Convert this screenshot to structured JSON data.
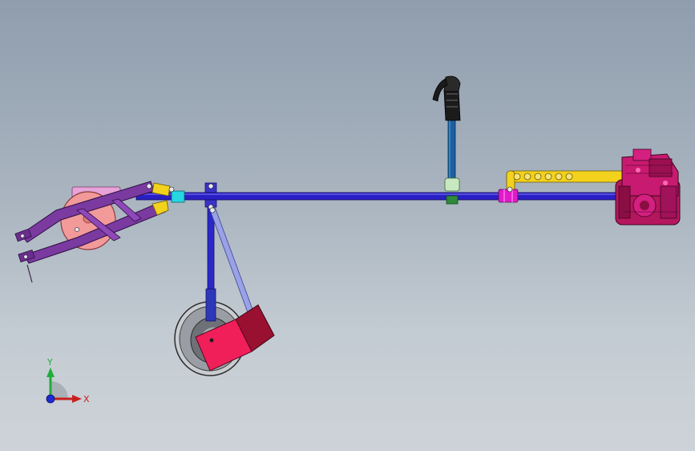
{
  "triad": {
    "y_label": "Y",
    "x_label": "X"
  },
  "colors": {
    "background_top": "#8f9dad",
    "background_bottom": "#cdd3d8",
    "main_beam": "#2a1fc4",
    "arm_purple": "#7a3aa0",
    "wheel_pink": "#f29a9a",
    "yellow_parts": "#f2d21c",
    "cyan_block": "#27d6e0",
    "handle_pole": "#1a5fa0",
    "grip": "#1b1b1b",
    "magenta_collar": "#e01bc8",
    "engine": "#b5175e",
    "red_box_front": "#f01f5a",
    "red_box_back": "#9a1030",
    "support_wheel": "#8b8f96"
  },
  "icons": [
    "coordinate-triad-icon"
  ]
}
